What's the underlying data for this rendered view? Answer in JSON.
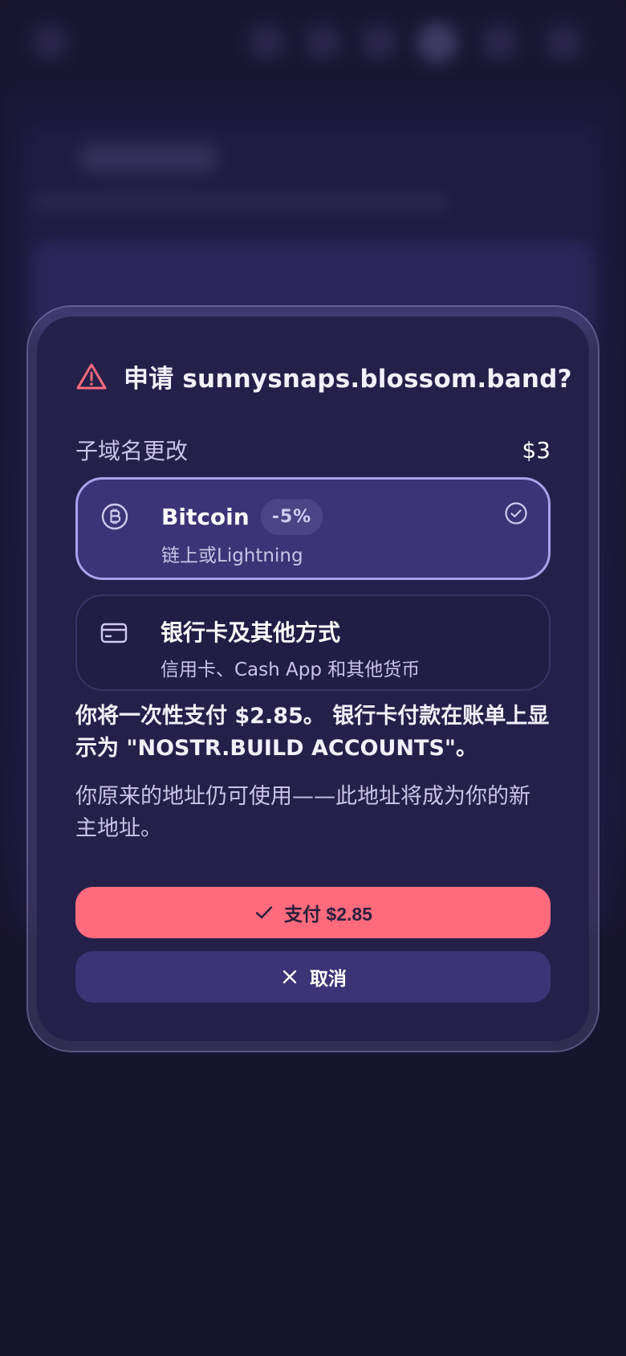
{
  "modal": {
    "title": "申请 sunnysnaps.blossom.band?",
    "item_label": "子域名更改",
    "item_price": "$3",
    "options": [
      {
        "icon": "bitcoin-icon",
        "title": "Bitcoin",
        "badge": "-5%",
        "subtitle": "链上或Lightning",
        "selected": true
      },
      {
        "icon": "credit-card-icon",
        "title": "银行卡及其他方式",
        "subtitle": "信用卡、Cash App 和其他货币",
        "selected": false
      }
    ],
    "notice": "你将一次性支付 $2.85。 银行卡付款在账单上显示为 \"NOSTR.BUILD ACCOUNTS\"。",
    "note": "你原来的地址仍可使用——此地址将成为你的新主地址。",
    "pay_button": "支付 $2.85",
    "cancel_button": "取消"
  },
  "colors": {
    "accent": "#ff6b7c",
    "selected_border": "#aaa1ec",
    "modal_bg": "#25204a",
    "page_bg": "#1b1835"
  }
}
